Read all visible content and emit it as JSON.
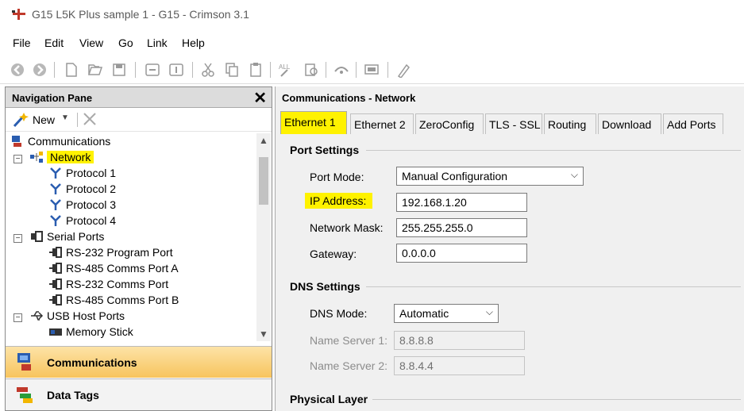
{
  "window": {
    "title": "G15 L5K Plus sample 1 - G15 - Crimson 3.1"
  },
  "menu": [
    {
      "label": "File"
    },
    {
      "label": "Edit"
    },
    {
      "label": "View"
    },
    {
      "label": "Go"
    },
    {
      "label": "Link"
    },
    {
      "label": "Help"
    }
  ],
  "toolbar": {
    "icons": [
      "back-icon",
      "forward-icon",
      "new-file-icon",
      "open-icon",
      "save-icon",
      "undo-icon",
      "redo-icon",
      "cut-icon",
      "copy-icon",
      "paste-icon",
      "find-icon",
      "replace-icon",
      "link-icon",
      "monitor-icon",
      "translate-icon"
    ]
  },
  "nav": {
    "title": "Navigation Pane",
    "close": "✕",
    "new_label": "New",
    "tree": [
      {
        "label": "Communications"
      },
      {
        "label": "Network"
      },
      {
        "label": "Protocol 1"
      },
      {
        "label": "Protocol 2"
      },
      {
        "label": "Protocol 3"
      },
      {
        "label": "Protocol 4"
      },
      {
        "label": "Serial Ports"
      },
      {
        "label": "RS-232 Program Port"
      },
      {
        "label": "RS-485 Comms Port A"
      },
      {
        "label": "RS-232 Comms Port"
      },
      {
        "label": "RS-485 Comms Port B"
      },
      {
        "label": "USB Host Ports"
      },
      {
        "label": "Memory Stick"
      }
    ],
    "sections": [
      {
        "label": "Communications"
      },
      {
        "label": "Data Tags"
      }
    ]
  },
  "panel": {
    "title": "Communications - Network",
    "tabs": [
      {
        "label": "Ethernet 1"
      },
      {
        "label": "Ethernet 2"
      },
      {
        "label": "ZeroConfig"
      },
      {
        "label": "TLS - SSL"
      },
      {
        "label": "Routing"
      },
      {
        "label": "Download"
      },
      {
        "label": "Add Ports"
      }
    ],
    "port_settings": {
      "title": "Port Settings",
      "port_mode_label": "Port Mode:",
      "port_mode_value": "Manual Configuration",
      "ip_label": "IP Address:",
      "ip_value": "192.168.1.20",
      "mask_label": "Network Mask:",
      "mask_value": "255.255.255.0",
      "gateway_label": "Gateway:",
      "gateway_value": "0.0.0.0"
    },
    "dns_settings": {
      "title": "DNS Settings",
      "mode_label": "DNS Mode:",
      "mode_value": "Automatic",
      "ns1_label": "Name Server 1:",
      "ns1_value": "8.8.8.8",
      "ns2_label": "Name Server 2:",
      "ns2_value": "8.8.4.4"
    },
    "physical_layer": {
      "title": "Physical Layer"
    }
  },
  "colors": {
    "highlight": "#fff200",
    "active_section": "#f7c45d"
  }
}
